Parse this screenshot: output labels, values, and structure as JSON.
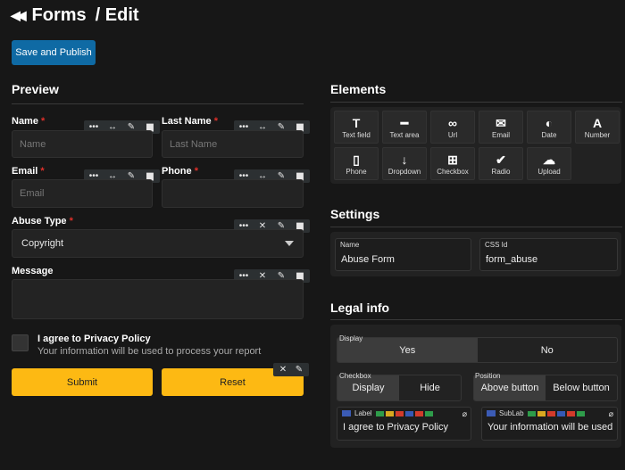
{
  "header": {
    "title": "Forms",
    "subtitle": "/ Edit",
    "publish_label": "Save and Publish"
  },
  "preview": {
    "heading": "Preview",
    "name": {
      "label": "Name",
      "placeholder": "Name"
    },
    "last_name": {
      "label": "Last Name",
      "placeholder": "Last Name"
    },
    "email": {
      "label": "Email",
      "placeholder": "Email"
    },
    "phone": {
      "label": "Phone",
      "placeholder": ""
    },
    "abuse_type": {
      "label": "Abuse Type",
      "value": "Copyright"
    },
    "message": {
      "label": "Message"
    },
    "privacy": {
      "label": "I agree to Privacy Policy",
      "sub": "Your information will be used to process your report"
    },
    "submit_label": "Submit",
    "reset_label": "Reset",
    "required_mark": "*"
  },
  "elements": {
    "heading": "Elements",
    "items": [
      {
        "icon": "text-field-icon",
        "glyph": "T",
        "label": "Text field"
      },
      {
        "icon": "text-area-icon",
        "glyph": "━",
        "label": "Text area"
      },
      {
        "icon": "link-icon",
        "glyph": "∞",
        "label": "Url"
      },
      {
        "icon": "email-icon",
        "glyph": "✉",
        "label": "Email"
      },
      {
        "icon": "date-icon",
        "glyph": "◐",
        "label": "Date"
      },
      {
        "icon": "number-icon",
        "glyph": "A",
        "label": "Number"
      },
      {
        "icon": "phone-icon",
        "glyph": "▯",
        "label": "Phone"
      },
      {
        "icon": "dropdown-icon",
        "glyph": "↓",
        "label": "Dropdown"
      },
      {
        "icon": "checkbox-icon",
        "glyph": "⊞",
        "label": "Checkbox"
      },
      {
        "icon": "radio-icon",
        "glyph": "✔",
        "label": "Radio"
      },
      {
        "icon": "upload-icon",
        "glyph": "☁",
        "label": "Upload"
      }
    ]
  },
  "settings": {
    "heading": "Settings",
    "name_caption": "Name",
    "name_value": "Abuse Form",
    "css_caption": "CSS Id",
    "css_value": "form_abuse"
  },
  "legal": {
    "heading": "Legal info",
    "display_caption": "Display",
    "yes": "Yes",
    "no": "No",
    "checkbox_caption": "Checkbox",
    "cb_display": "Display",
    "cb_hide": "Hide",
    "position_caption": "Position",
    "above": "Above button",
    "below": "Below button",
    "label_caption": "Label",
    "label_value": "I agree to Privacy Policy",
    "sublab_caption": "SubLab",
    "sublab_value": "Your information will be used"
  },
  "colors": {
    "accent_blue": "#0f6aa4",
    "button_yellow": "#fdb913",
    "required_red": "#e0302a"
  }
}
